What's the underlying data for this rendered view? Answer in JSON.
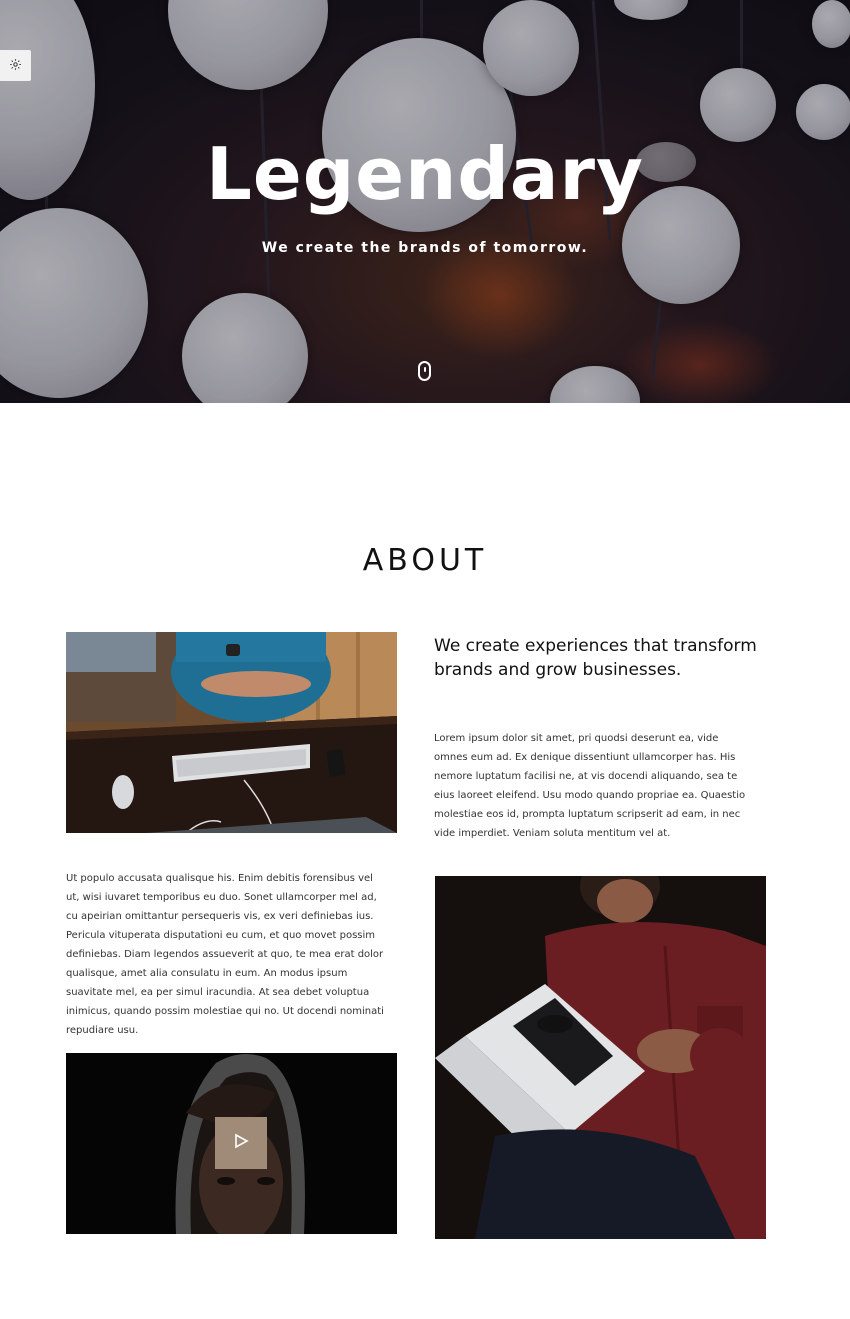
{
  "hero": {
    "title": "Legendary",
    "subtitle": "We create the brands of tomorrow.",
    "settings_icon": "gear-icon",
    "scroll_icon": "mouse-scroll-icon"
  },
  "about": {
    "section_title": "ABOUT",
    "headline": "We create experiences that transform brands and grow businesses.",
    "paragraph_right": "Lorem ipsum dolor sit amet, pri quodsi deserunt ea, vide omnes eum ad. Ex denique dissentiunt ullamcorper has. His nemore luptatum facilisi ne, at vis docendi aliquando, sea te eius laoreet eleifend. Usu modo quando propriae ea. Quaestio molestiae eos id, prompta luptatum scripserit ad eam, in nec vide imperdiet. Veniam soluta mentitum vel at.",
    "paragraph_left": "Ut populo accusata qualisque his. Enim debitis forensibus vel ut, wisi iuvaret temporibus eu duo. Sonet ullamcorper mel ad, cu apeirian omittantur persequeris vis, ex veri definiebas ius. Pericula vituperata disputationi eu cum, et quo movet possim definiebas. Diam legendos assueverit at quo, te mea erat dolor qualisque, amet alia consulatu in eum. An modus ipsum suavitate mel, ea per simul iracundia. At sea debet voluptua inimicus, quando possim molestiae qui no. Ut docendi nominati repudiare usu.",
    "play_icon": "play-icon"
  },
  "colors": {
    "accent": "#a08b78",
    "text": "#111111"
  }
}
